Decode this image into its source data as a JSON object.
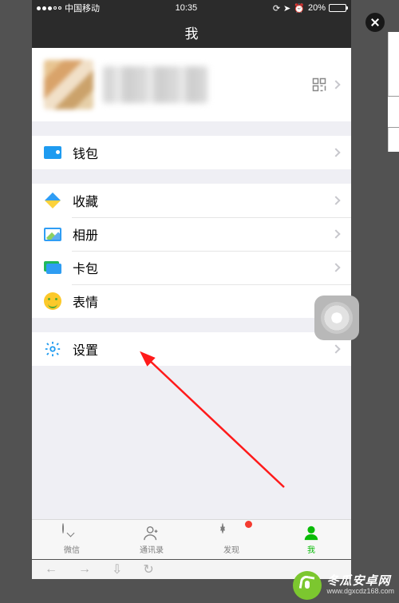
{
  "status": {
    "carrier": "中国移动",
    "time": "10:35",
    "battery_pct": "20%"
  },
  "nav": {
    "title": "我"
  },
  "menu": {
    "wallet": "钱包",
    "favorites": "收藏",
    "album": "相册",
    "cards": "卡包",
    "stickers": "表情",
    "settings": "设置"
  },
  "tabs": {
    "chats": "微信",
    "contacts": "通讯录",
    "discover": "发现",
    "me": "我"
  },
  "watermark": {
    "brand": "冬瓜安卓网",
    "url": "www.dgxcdz168.com"
  }
}
